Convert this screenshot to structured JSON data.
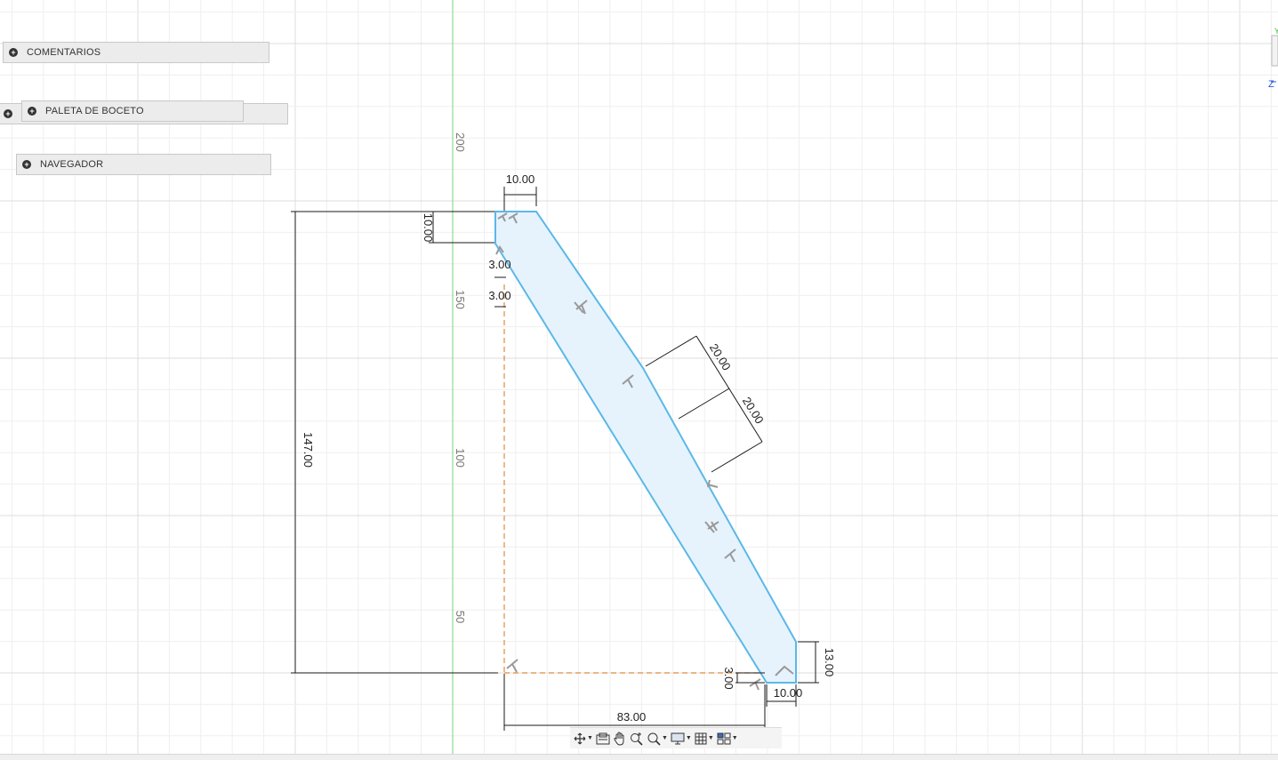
{
  "panels": {
    "comments": "COMENTARIOS",
    "sketch_palette": "PALETA DE BOCETO",
    "navigator": "NAVEGADOR"
  },
  "grid_labels": [
    "200",
    "150",
    "100",
    "50"
  ],
  "dimensions": {
    "top_width": "10.00",
    "top_offset": "10.00",
    "thickness_a": "3.00",
    "thickness_b": "3.00",
    "total_height": "147.00",
    "diag_a": "20.00",
    "diag_b": "20.00",
    "right_height": "13.00",
    "bottom_small": "3.00",
    "bottom_width": "10.00",
    "base_length": "83.00"
  },
  "view_cube": {
    "y_axis": "Y",
    "z_axis": "Z"
  },
  "toolbar_icons": [
    "orbit-icon",
    "look-at-icon",
    "pan-icon",
    "zoom-icon",
    "fit-icon",
    "display-settings-icon",
    "grid-settings-icon",
    "viewports-icon"
  ],
  "colors": {
    "profile_stroke": "#5bb8e8",
    "profile_fill": "#e6f3fc",
    "construction": "#e08a3c",
    "axis_green": "#7fd17f",
    "dimension": "#1a1a1a"
  }
}
